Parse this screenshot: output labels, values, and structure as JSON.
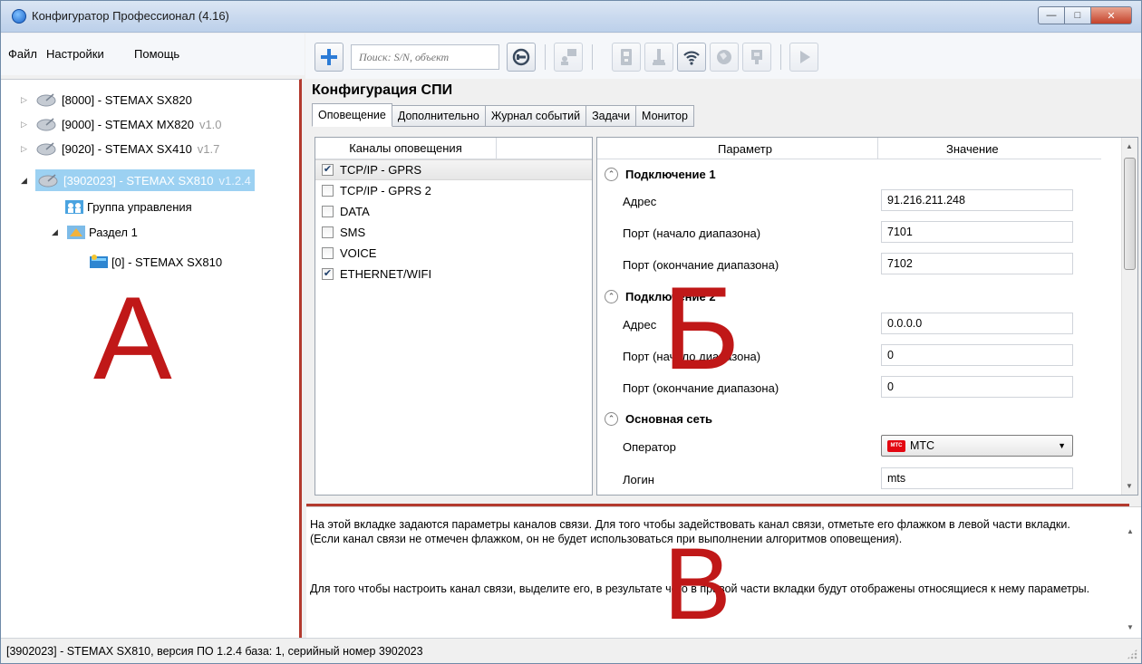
{
  "window": {
    "title": "Конфигуратор Профессионал (4.16)"
  },
  "menu": {
    "file": "Файл",
    "settings": "Настройки",
    "help": "Помощь"
  },
  "toolbar": {
    "search_placeholder": "Поиск: S/N, объект"
  },
  "tree": {
    "devices": [
      {
        "label": "[8000] - STEMAX SX820",
        "version": ""
      },
      {
        "label": "[9000] - STEMAX MX820",
        "version": "v1.0"
      },
      {
        "label": "[9020] - STEMAX SX410",
        "version": "v1.7"
      },
      {
        "label": "[3902023] - STEMAX SX810",
        "version": "v1.2.4"
      }
    ],
    "control_group": "Группа управления",
    "section": "Раздел 1",
    "section_device": "[0] - STEMAX SX810"
  },
  "letters": {
    "a": "А",
    "b": "Б",
    "c": "В"
  },
  "config": {
    "title": "Конфигурация СПИ",
    "tabs": [
      "Оповещение",
      "Дополнительно",
      "Журнал событий",
      "Задачи",
      "Монитор"
    ],
    "active_tab": 0
  },
  "channels": {
    "header": "Каналы оповещения",
    "items": [
      {
        "label": "TCP/IP - GPRS",
        "checked": true
      },
      {
        "label": "TCP/IP - GPRS 2",
        "checked": false
      },
      {
        "label": "DATA",
        "checked": false
      },
      {
        "label": "SMS",
        "checked": false
      },
      {
        "label": "VOICE",
        "checked": false
      },
      {
        "label": "ETHERNET/WIFI",
        "checked": true
      }
    ]
  },
  "params": {
    "header_param": "Параметр",
    "header_value": "Значение",
    "group1": {
      "title": "Подключение 1",
      "address_label": "Адрес",
      "address_value": "91.216.211.248",
      "port_start_label": "Порт (начало диапазона)",
      "port_start_value": "7101",
      "port_end_label": "Порт (окончание диапазона)",
      "port_end_value": "7102"
    },
    "group2": {
      "title": "Подключение 2",
      "address_label": "Адрес",
      "address_value": "0.0.0.0",
      "port_start_label": "Порт (начало диапазона)",
      "port_start_value": "0",
      "port_end_label": "Порт (окончание диапазона)",
      "port_end_value": "0"
    },
    "group3": {
      "title": "Основная сеть",
      "operator_label": "Оператор",
      "operator_value": "МТС",
      "login_label": "Логин",
      "login_value": "mts"
    }
  },
  "help": {
    "p1": "На этой вкладке задаются параметры каналов связи. Для того чтобы задействовать канал связи, отметьте его флажком в левой части вкладки. (Если канал связи не отмечен флажком, он не будет использоваться при выполнении алгоритмов оповещения).",
    "p2": "Для того чтобы настроить канал связи, выделите его, в результате чего в правой части вкладки будут отображены относящиеся к нему параметры."
  },
  "status": {
    "text": "[3902023] - STEMAX SX810, версия ПО 1.2.4 база: 1, серийный номер 3902023"
  },
  "colors": {
    "accent_red": "#c01818",
    "selection": "#9cd1f2",
    "mts_red": "#e30611"
  }
}
